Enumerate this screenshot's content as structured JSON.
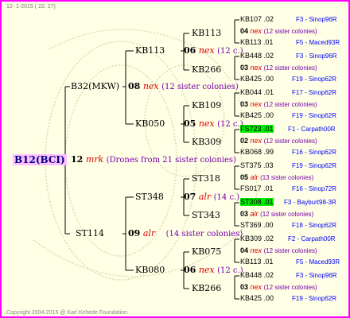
{
  "header": "12-  1-2015 ( 22: 27)",
  "copyright": "Copyright 2004-2015 @ Karl Kehede Foundation.",
  "root": {
    "id": "B12(BCI)",
    "num": "12",
    "grp": "mrk",
    "note": "(Drones from 21 sister colonies)"
  },
  "gen1": [
    {
      "id": "B32(MKW)",
      "num": "08",
      "grp": "nex",
      "note": "(12 sister colonies)"
    },
    {
      "id": "ST114",
      "num": "09",
      "grp": "alr",
      "note": "(14 sister colonies)"
    }
  ],
  "gen2": [
    {
      "id": "KB113",
      "num": "06",
      "grp": "nex",
      "note": "(12 c.)"
    },
    {
      "id": "KB050",
      "num": "05",
      "grp": "nex",
      "note": "(12 c.)"
    },
    {
      "id": "ST348",
      "num": "07",
      "grp": "alr",
      "note": "(14 c.)"
    },
    {
      "id": "KB080",
      "num": "06",
      "grp": "nex",
      "note": "(12 c.)"
    }
  ],
  "gen3": [
    "KB113",
    "KB266",
    "KB109",
    "KB309",
    "ST318",
    "ST343",
    "KB075",
    "KB266"
  ],
  "gen4": [
    {
      "a_id": "KB107",
      "a_num": ".02",
      "a_src": "F3 - Sinop96R",
      "m_num": "04",
      "m_grp": "nex",
      "m_note": "(12 sister colonies)",
      "b_id": "KB113",
      "b_num": ".01",
      "b_src": "F5 - Maced93R"
    },
    {
      "a_id": "KB448",
      "a_num": ".02",
      "a_src": "F3 - Sinop96R",
      "m_num": "03",
      "m_grp": "nex",
      "m_note": "(12 sister colonies)",
      "b_id": "KB425",
      "b_num": ".00",
      "b_src": "F19 - Sinop62R"
    },
    {
      "a_id": "KB044",
      "a_num": ".01",
      "a_src": "F17 - Sinop62R",
      "m_num": "03",
      "m_grp": "nex",
      "m_note": "(12 sister colonies)",
      "b_id": "KB425",
      "b_num": ".00",
      "b_src": "F19 - Sinop62R"
    },
    {
      "a_id": "FS723",
      "a_num": ".01",
      "a_src": "F1 - Carpath00R",
      "m_num": "02",
      "m_grp": "nex",
      "m_note": "(12 sister colonies)",
      "b_id": "KB068",
      "b_num": ".99",
      "b_src": "F16 - Sinop62R"
    },
    {
      "a_id": "ST375",
      "a_num": ".03",
      "a_src": "F19 - Sinop62R",
      "m_num": "05",
      "m_grp": "alr",
      "m_note": "(13 sister colonies)",
      "b_id": "FS017",
      "b_num": ".01",
      "b_src": "F16 - Sinop72R"
    },
    {
      "a_id": "ST308",
      "a_num": ".01",
      "a_src": "F3 - Bayburt98-3R",
      "m_num": "03",
      "m_grp": "alr",
      "m_note": "(12 sister colonies)",
      "b_id": "ST369",
      "b_num": ".00",
      "b_src": "F18 - Sinop62R"
    },
    {
      "a_id": "KB309",
      "a_num": ".02",
      "a_src": "F2 - Carpath00R",
      "m_num": "04",
      "m_grp": "nex",
      "m_note": "(12 sister colonies)",
      "b_id": "KB113",
      "b_num": ".01",
      "b_src": "F5 - Maced93R"
    },
    {
      "a_id": "KB448",
      "a_num": ".02",
      "a_src": "F3 - Sinop96R",
      "m_num": "03",
      "m_grp": "nex",
      "m_note": "(12 sister colonies)",
      "b_id": "KB425",
      "b_num": ".00",
      "b_src": "F19 - Sinop62R"
    }
  ]
}
